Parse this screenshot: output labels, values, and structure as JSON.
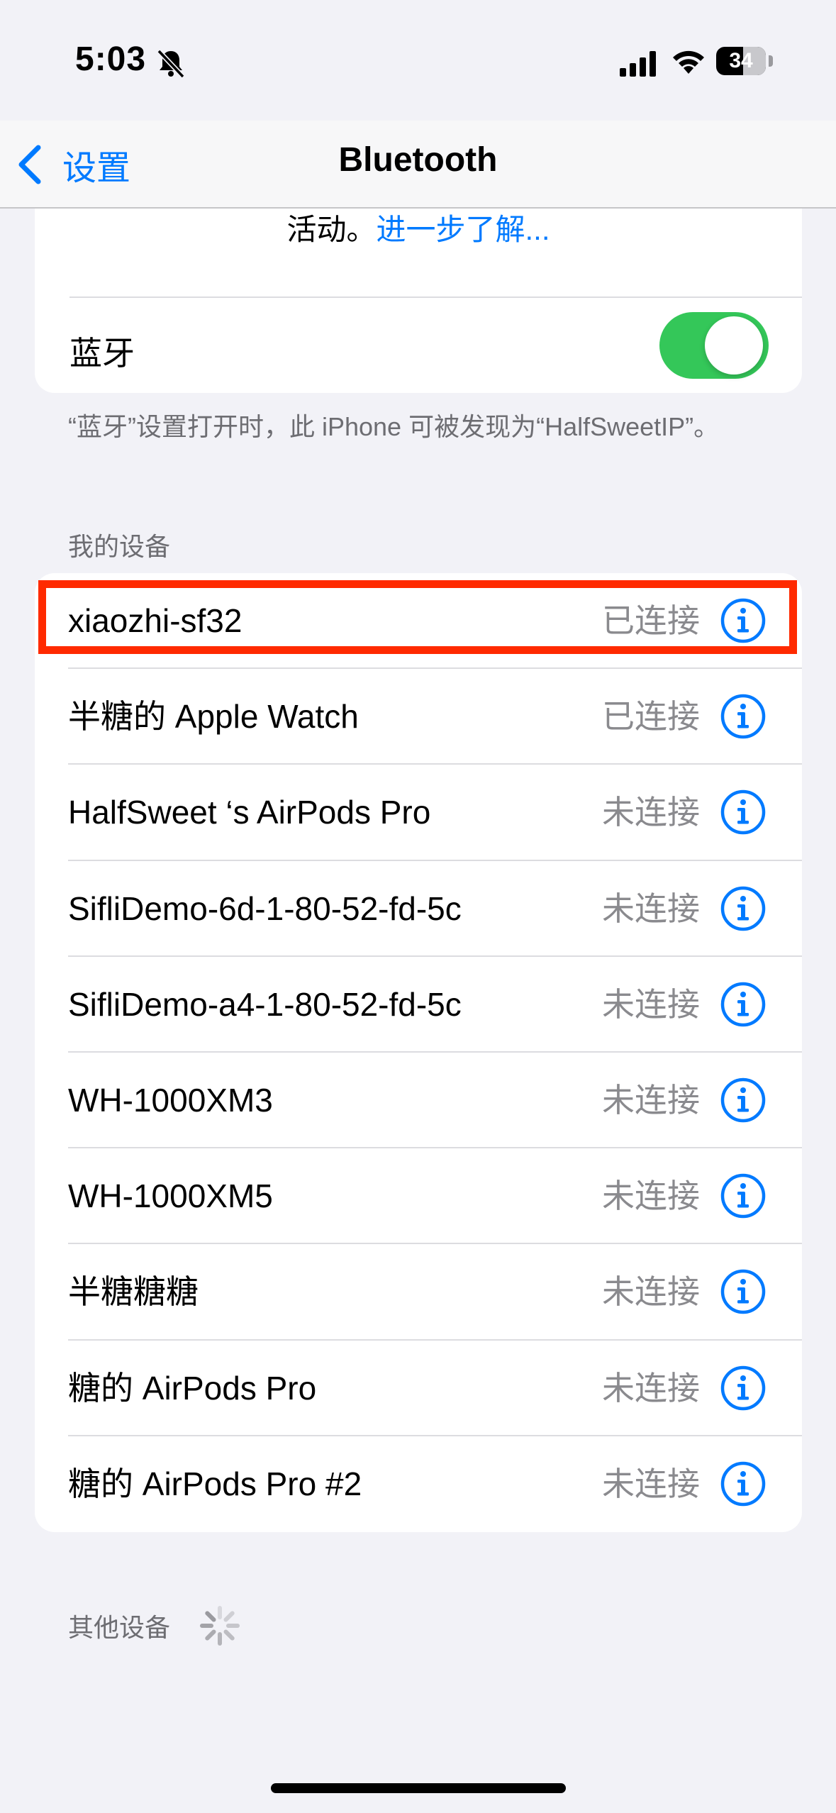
{
  "status_bar": {
    "time": "5:03",
    "battery": "34",
    "icons": [
      "bell-slash-icon",
      "cellular-signal-icon",
      "wifi-icon",
      "battery-icon"
    ]
  },
  "nav": {
    "back_label": "设置",
    "title": "Bluetooth"
  },
  "bluetooth_card": {
    "intro_text": "活动。",
    "learn_more_link": "进一步了解...",
    "toggle_label": "蓝牙",
    "toggle_on": true
  },
  "footnote": "“蓝牙”设置打开时，此 iPhone 可被发现为“HalfSweetIP”。",
  "my_devices": {
    "header": "我的设备",
    "items": [
      {
        "name": "xiaozhi-sf32",
        "status": "已连接"
      },
      {
        "name": "半糖的 Apple Watch",
        "status": "已连接"
      },
      {
        "name": "HalfSweet ‘s AirPods Pro",
        "status": "未连接"
      },
      {
        "name": "SifliDemo-6d-1-80-52-fd-5c",
        "status": "未连接"
      },
      {
        "name": "SifliDemo-a4-1-80-52-fd-5c",
        "status": "未连接"
      },
      {
        "name": "WH-1000XM3",
        "status": "未连接"
      },
      {
        "name": "WH-1000XM5",
        "status": "未连接"
      },
      {
        "name": "半糖糖糖",
        "status": "未连接"
      },
      {
        "name": "糖的 AirPods Pro",
        "status": "未连接"
      },
      {
        "name": "糖的 AirPods Pro #2",
        "status": "未连接"
      }
    ]
  },
  "other_devices": {
    "header": "其他设备"
  },
  "colors": {
    "accent": "#007aff",
    "toggle_on": "#34c759",
    "highlight": "#ff2a00",
    "background": "#f2f2f7"
  }
}
